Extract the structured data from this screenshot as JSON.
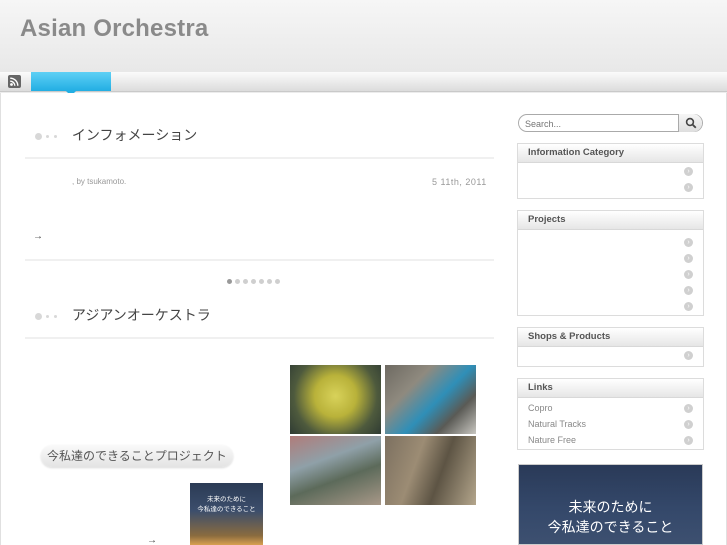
{
  "site": {
    "title": "Asian Orchestra"
  },
  "nav": {
    "rss_icon": "rss-icon",
    "accent": "#22aee3"
  },
  "posts": [
    {
      "title": "インフォメーション",
      "author_line": ", by tsukamoto.",
      "date": "5  11th, 2011",
      "more": "→"
    },
    {
      "title": "アジアンオーケストラ",
      "project_label": "今私達のできることプロジェクト",
      "poster_text_1": "未来のために",
      "poster_text_2": "今私達のできること",
      "more": "→"
    }
  ],
  "pager": {
    "count": 7,
    "active": 0
  },
  "search": {
    "placeholder": "Search...",
    "icon": "search-icon"
  },
  "sidebar": {
    "info_category": {
      "title": "Information Category",
      "items": [
        "",
        ""
      ]
    },
    "projects": {
      "title": "Projects",
      "items": [
        "",
        "",
        "",
        "",
        ""
      ]
    },
    "shops": {
      "title": "Shops & Products",
      "items": [
        ""
      ]
    },
    "links": {
      "title": "Links",
      "items": [
        "Copro",
        "Natural Tracks",
        "Nature Free"
      ]
    },
    "banner": {
      "line1": "未来のために",
      "line2": "今私達のできること"
    }
  }
}
